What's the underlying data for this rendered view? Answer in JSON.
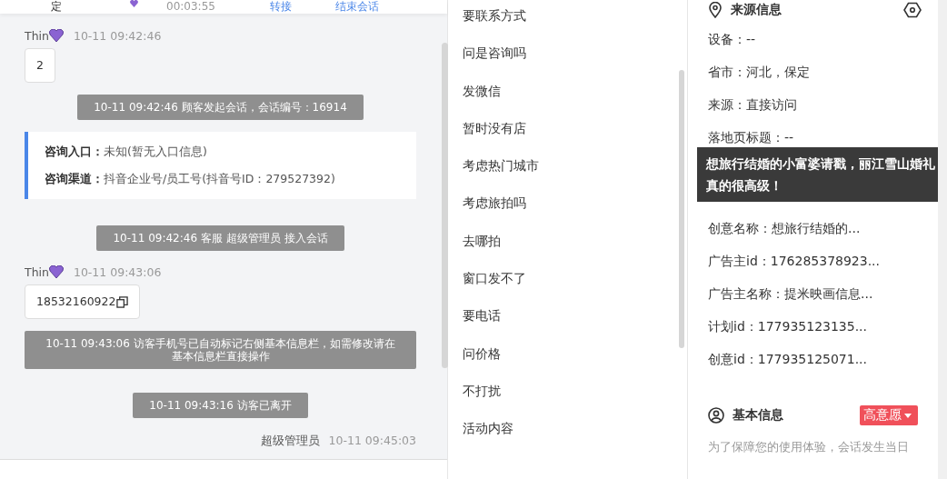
{
  "chat_header": {
    "items": [
      {
        "kind": "text",
        "text": "定"
      },
      {
        "kind": "heart"
      },
      {
        "kind": "time",
        "text": "00:03:55"
      },
      {
        "kind": "link",
        "text": "转接"
      },
      {
        "kind": "link",
        "text": "结束会话"
      }
    ]
  },
  "messages": [
    {
      "kind": "visitor",
      "name": "Thin",
      "time": "10-11 09:42:46",
      "text": "2",
      "copy": false
    },
    {
      "kind": "system",
      "text": "10-11 09:42:46 顾客发起会话，会话编号：16914"
    },
    {
      "kind": "entry",
      "rows": [
        {
          "label": "咨询入口：",
          "value": "未知(暂无入口信息)"
        },
        {
          "label": "咨询渠道：",
          "value": "抖音企业号/员工号(抖音号ID：279527392)"
        }
      ]
    },
    {
      "kind": "system",
      "text": "10-11 09:42:46 客服 超级管理员 接入会话"
    },
    {
      "kind": "visitor",
      "name": "Thin",
      "time": "10-11 09:43:06",
      "text": "18532160922",
      "copy": true
    },
    {
      "kind": "system",
      "text": "10-11 09:43:06 访客手机号已自动标记右侧基本信息栏，如需修改请在基本信息栏直接操作"
    },
    {
      "kind": "system",
      "text": "10-11 09:43:16 访客已离开"
    },
    {
      "kind": "agent",
      "name": "超级管理员",
      "time": "10-11 09:45:03"
    }
  ],
  "quick_replies": [
    "要联系方式",
    "问是咨询吗",
    "发微信",
    "暂时没有店",
    "考虑热门城市",
    "考虑旅拍吗",
    "去哪拍",
    "窗口发不了",
    "要电话",
    "问价格",
    "不打扰",
    "活动内容"
  ],
  "source_info": {
    "title": "来源信息",
    "rows_before": [
      "设备：--",
      "省市：河北，保定",
      "来源：直接访问",
      "落地页标题：--"
    ],
    "tooltip": "想旅行结婚的小富婆请戳，丽江雪山婚礼真的很高级！",
    "rows_after": [
      "创意名称：想旅行结婚的...",
      "广告主id：176285378923...",
      "广告主名称：提米映画信息...",
      "计划id：177935123135...",
      "创意id：177935125071..."
    ]
  },
  "basic_info": {
    "title": "基本信息",
    "tag": {
      "text": "高意愿",
      "color": "#f0505a"
    },
    "note": "为了保障您的使用体验，会话发生当日"
  }
}
